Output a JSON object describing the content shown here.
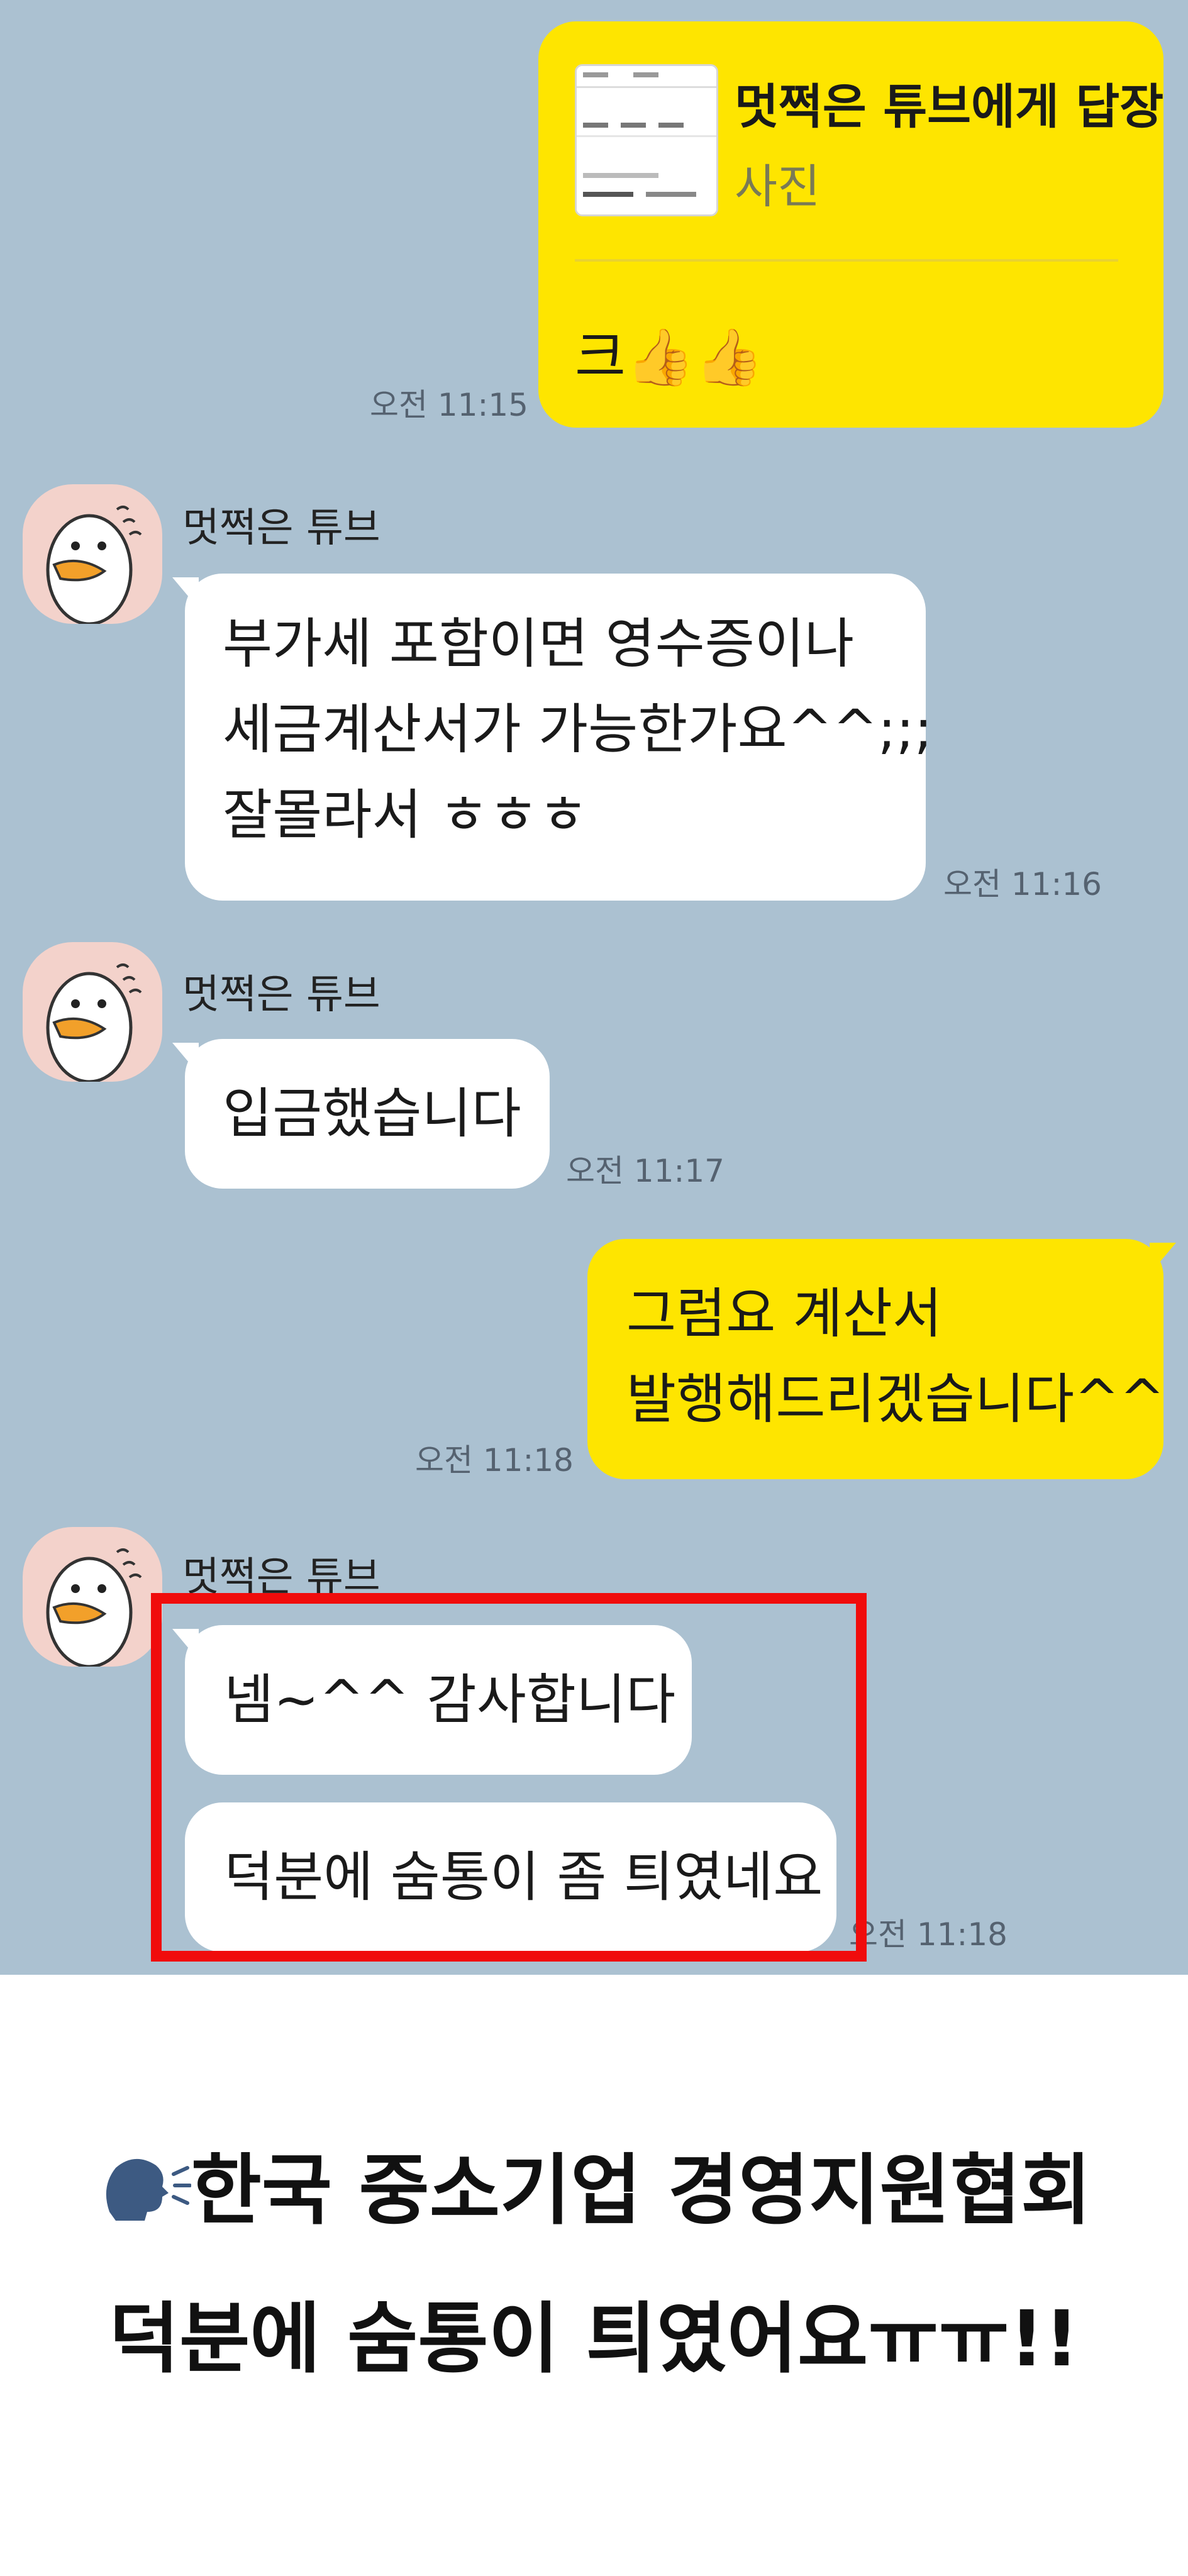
{
  "chat": {
    "reply_card": {
      "title": "멋쩍은 튜브에게 답장",
      "subtitle": "사진",
      "message": "크👍👍",
      "time": "오전 11:15"
    },
    "messages": [
      {
        "sender": "멋쩍은 튜브",
        "lines": [
          "부가세 포함이면 영수증이나",
          "세금계산서가 가능한가요^^;;;",
          "잘몰라서 ㅎㅎㅎ"
        ],
        "time": "오전 11:16"
      },
      {
        "sender": "멋쩍은 튜브",
        "lines": [
          "입금했습니다"
        ],
        "time": "오전 11:17"
      },
      {
        "sender": "",
        "lines": [
          "그럼요 계산서",
          "발행해드리겠습니다^^"
        ],
        "time": "오전 11:18"
      },
      {
        "sender": "멋쩍은 튜브",
        "lines": [
          "넴~^^  감사합니다",
          "덕분에 숨통이 좀 틔였네요"
        ],
        "time": "오전 11:18"
      }
    ]
  },
  "footer": {
    "line1": "한국 중소기업 경영지원협회",
    "line2": "덕분에 숨통이 틔였어요ㅠㅠ!!"
  },
  "icons": [
    "speaking-head-icon",
    "thumbs-up-icon",
    "duck-avatar-icon"
  ],
  "colors": {
    "chat_background": "#abc1d1",
    "outgoing_bubble": "#fee500",
    "incoming_bubble": "#ffffff",
    "highlight_box": "#f00c0c"
  }
}
